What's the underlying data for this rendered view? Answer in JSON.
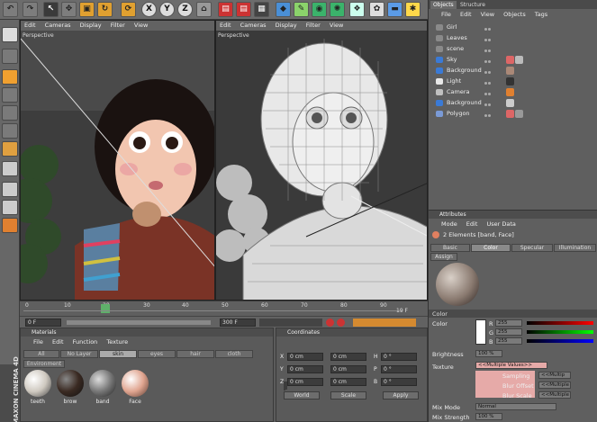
{
  "top_toolbar": {
    "x_label": "X",
    "y_label": "Y",
    "z_label": "Z"
  },
  "viewport_left": {
    "menu": [
      "Edit",
      "Cameras",
      "Display",
      "Filter",
      "View"
    ],
    "camera_label": "Perspective"
  },
  "viewport_right": {
    "menu": [
      "Edit",
      "Cameras",
      "Display",
      "Filter",
      "View"
    ],
    "camera_label": "Perspective"
  },
  "timeline": {
    "ticks": [
      "0",
      "10",
      "20",
      "30",
      "40",
      "50",
      "60",
      "70",
      "80",
      "90"
    ],
    "end_frame": "19 F",
    "start_field": "0 F",
    "end_field": "300 F"
  },
  "materials": {
    "title": "Materials",
    "menu": [
      "File",
      "Edit",
      "Function",
      "Texture"
    ],
    "tabs": [
      "All",
      "No Layer",
      "skin",
      "eyes",
      "hair",
      "cloth"
    ],
    "layer_label": "Environment",
    "items": [
      {
        "name": "teeth"
      },
      {
        "name": "brow"
      },
      {
        "name": "band"
      },
      {
        "name": "Face"
      }
    ]
  },
  "coordinates": {
    "title": "Coordinates",
    "rows": [
      {
        "axis": "X",
        "val": "0 cm",
        "haxis": "H",
        "hval": "0 °"
      },
      {
        "axis": "Y",
        "val": "0 cm",
        "haxis": "P",
        "hval": "0 °"
      },
      {
        "axis": "Z",
        "val": "0 cm",
        "haxis": "B",
        "hval": "0 °"
      }
    ],
    "world": "World",
    "scale": "Scale",
    "apply": "Apply"
  },
  "objects": {
    "tabs": [
      "Objects",
      "Structure"
    ],
    "menu": [
      "File",
      "Edit",
      "View",
      "Objects",
      "Tags"
    ],
    "items": [
      {
        "name": "Girl",
        "color": "#8a8a8a"
      },
      {
        "name": "Leaves",
        "color": "#8a8a8a"
      },
      {
        "name": "scene",
        "color": "#8a8a8a"
      },
      {
        "name": "Sky",
        "color": "#3a7ad6"
      },
      {
        "name": "Background",
        "color": "#3a7ad6"
      },
      {
        "name": "Light",
        "color": "#e8e8e8"
      },
      {
        "name": "Camera",
        "color": "#c0c0c0"
      },
      {
        "name": "Background",
        "color": "#3a7ad6"
      },
      {
        "name": "Polygon",
        "color": "#7a9ad6"
      }
    ]
  },
  "attributes": {
    "title": "Attributes",
    "menu": [
      "Mode",
      "Edit",
      "User Data"
    ],
    "selection": "2 Elements [band, Face]",
    "tabs": [
      "Basic",
      "Color",
      "Specular",
      "Illumination"
    ],
    "assign_tab": "Assign",
    "section": "Color",
    "color_label": "Color",
    "r_label": "R",
    "g_label": "G",
    "b_label": "B",
    "r_val": "255",
    "g_val": "255",
    "b_val": "255",
    "brightness_label": "Brightness",
    "brightness_val": "100 %",
    "texture_label": "Texture",
    "texture_val": "<<Multiple Values>>",
    "sampling_label": "Sampling",
    "sampling_val": "<<Multip",
    "blur_offset_label": "Blur Offset",
    "blur_offset_val": "<<Multiple",
    "blur_scale_label": "Blur Scale",
    "blur_scale_val": "<<Multiple",
    "mix_mode_label": "Mix Mode",
    "mix_mode_val": "Normal",
    "mix_strength_label": "Mix Strength",
    "mix_strength_val": "100 %"
  },
  "brand": {
    "text": "MAXON CINEMA 4D"
  }
}
